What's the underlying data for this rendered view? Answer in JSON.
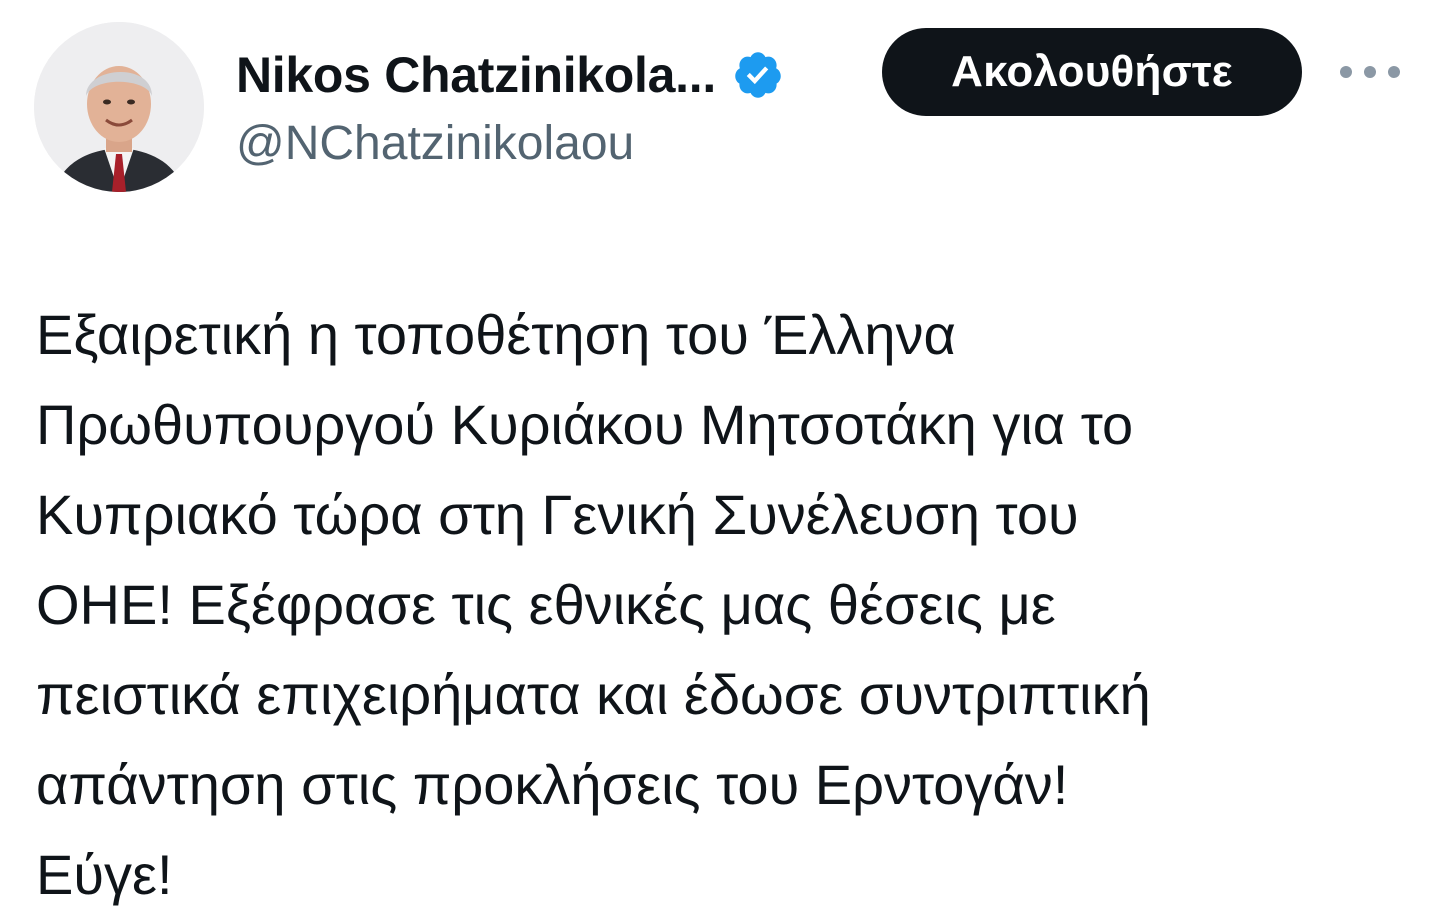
{
  "author": {
    "display_name": "Nikos Chatzinikola...",
    "handle": "@NChatzinikolaou",
    "verified_icon": "verified-badge-icon",
    "verified_color": "#1d9bf0"
  },
  "actions": {
    "follow_label": "Ακολουθήστε",
    "more_icon": "more-horizontal-icon"
  },
  "tweet": {
    "lines": [
      "Εξαιρετική η τοποθέτηση του Έλληνα",
      "Πρωθυπουργού Κυριάκου Μητσοτάκη για το",
      "Κυπριακό τώρα στη Γενική Συνέλευση του",
      "ΟΗΕ! Εξέφρασε τις εθνικές μας θέσεις με",
      "πειστικά επιχειρήματα και έδωσε συντριπτική",
      "απάντηση στις προκλήσεις του Ερντογάν!",
      "Εύγε!"
    ]
  },
  "colors": {
    "text": "#0f1419",
    "secondary_text": "#536471",
    "button_bg": "#0f1419",
    "button_text": "#ffffff"
  }
}
